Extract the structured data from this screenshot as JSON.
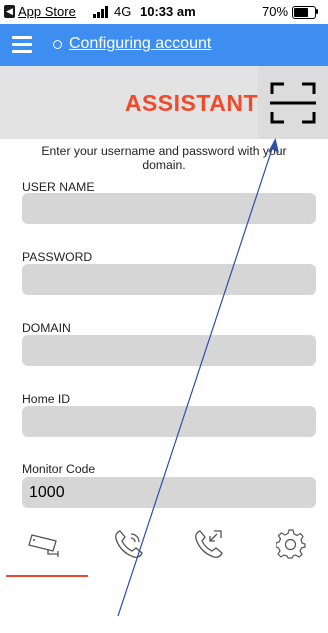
{
  "status_bar": {
    "back_app_label": "App Store",
    "network": "4G",
    "time": "10:33 am",
    "battery_percent": "70%",
    "battery_level": 0.7
  },
  "header": {
    "title": "Configuring account",
    "status_icon": "status-ring-icon",
    "menu_icon": "hamburger-menu-icon"
  },
  "banner": {
    "title": "ASSISTANT",
    "scan_icon": "qr-scan-icon"
  },
  "instructions": "Enter your username and password with your domain.",
  "fields": [
    {
      "label": "USER NAME",
      "value": ""
    },
    {
      "label": "PASSWORD",
      "value": ""
    },
    {
      "label": "DOMAIN",
      "value": ""
    },
    {
      "label": "Home ID",
      "value": ""
    },
    {
      "label": "Monitor Code",
      "value": "1000"
    }
  ],
  "tabs": [
    {
      "icon": "security-camera-icon",
      "selected": true
    },
    {
      "icon": "phone-call-icon",
      "selected": false
    },
    {
      "icon": "call-history-icon",
      "selected": false
    },
    {
      "icon": "settings-gear-icon",
      "selected": false
    }
  ],
  "colors": {
    "header_blue": "#3d8ef0",
    "accent_orange": "#f04a2c",
    "input_grey": "#d6d6d6",
    "banner_grey": "#e3e3e3",
    "annotation_arrow": "#2c4fa8"
  }
}
